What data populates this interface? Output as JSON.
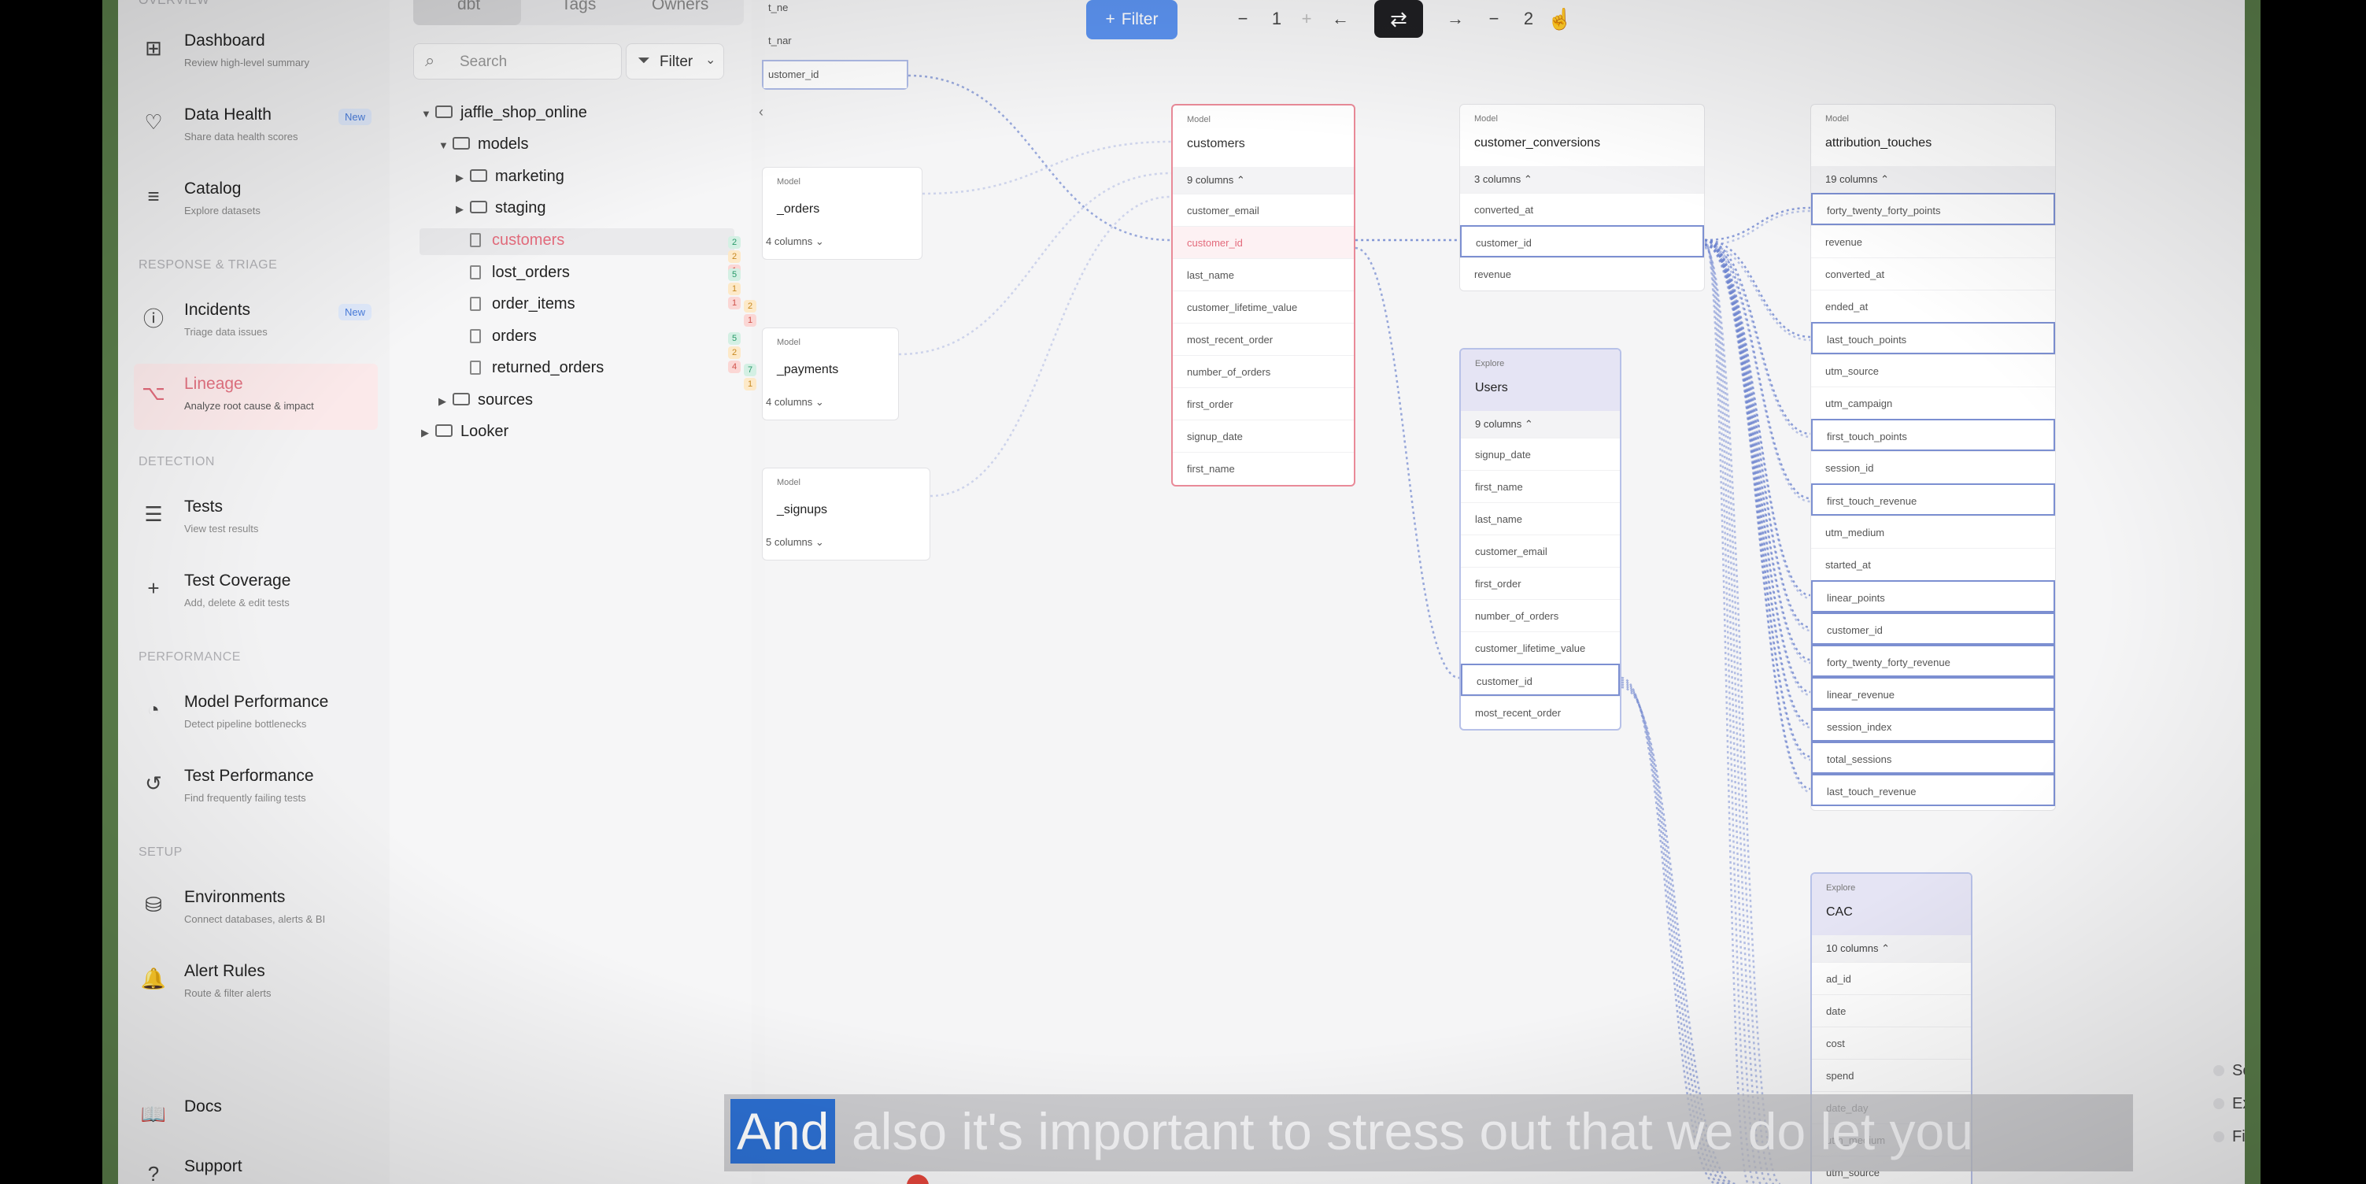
{
  "nav": {
    "section_top": "OVERVIEW",
    "items": [
      {
        "label": "Dashboard",
        "sub": "Review high-level summary",
        "icon": "dashboard-icon"
      },
      {
        "label": "Data Health",
        "sub": "Share data health scores",
        "icon": "heart-icon",
        "badge": "New"
      },
      {
        "label": "Catalog",
        "sub": "Explore datasets",
        "icon": "catalog-icon"
      },
      {
        "label": "Incidents",
        "sub": "Triage data issues",
        "icon": "alert-icon",
        "badge": "New"
      },
      {
        "label": "Lineage",
        "sub": "Analyze root cause & impact",
        "icon": "lineage-icon"
      },
      {
        "label": "Tests",
        "sub": "View test results",
        "icon": "list-icon"
      },
      {
        "label": "Test Coverage",
        "sub": "Add, delete & edit tests",
        "icon": "plus-icon"
      },
      {
        "label": "Model Performance",
        "sub": "Detect pipeline bottlenecks",
        "icon": "gauge-icon"
      },
      {
        "label": "Test Performance",
        "sub": "Find frequently failing tests",
        "icon": "history-icon"
      },
      {
        "label": "Environments",
        "sub": "Connect databases, alerts & BI",
        "icon": "database-icon"
      },
      {
        "label": "Alert Rules",
        "sub": "Route & filter alerts",
        "icon": "bell-icon"
      },
      {
        "label": "Docs",
        "icon": "book-icon"
      },
      {
        "label": "Support",
        "icon": "help-icon"
      }
    ],
    "sections": [
      "RESPONSE & TRIAGE",
      "DETECTION",
      "PERFORMANCE",
      "SETUP"
    ]
  },
  "tree": {
    "tabs": [
      "dbt",
      "Tags",
      "Owners"
    ],
    "search_placeholder": "Search",
    "filter_label": "Filter",
    "nodes": [
      {
        "label": "jaffle_shop_online"
      },
      {
        "label": "models"
      },
      {
        "label": "marketing"
      },
      {
        "label": "staging"
      },
      {
        "label": "customers"
      },
      {
        "label": "lost_orders"
      },
      {
        "label": "order_items"
      },
      {
        "label": "orders"
      },
      {
        "label": "returned_orders"
      },
      {
        "label": "sources"
      },
      {
        "label": "Looker"
      }
    ],
    "pills": {
      "customers": [
        "2",
        "2",
        "1"
      ],
      "lost_orders": [
        "5",
        "1",
        "1"
      ],
      "order_items": [
        "2",
        "1"
      ],
      "orders": [
        "5",
        "2",
        "4"
      ],
      "returned_orders": [
        "7",
        "1"
      ]
    }
  },
  "toolbar": {
    "filter_label": "Filter",
    "minus1": "−",
    "upstream_depth": "1",
    "plus1": "+",
    "left_arrow": "←",
    "swap": "⇄",
    "right_arrow": "→",
    "minus2": "−",
    "downstream_depth": "2"
  },
  "zoom": {
    "plus": "+",
    "minus": "−",
    "reset": "↺"
  },
  "cards": {
    "partial_top": {
      "label1": "t_ne",
      "label2": "t_nar",
      "row": "ustomer_id"
    },
    "orders": {
      "type": "Model",
      "name": "_orders",
      "cols": "4 columns"
    },
    "payments": {
      "type": "Model",
      "name": "_payments",
      "cols": "4 columns"
    },
    "signups": {
      "type": "Model",
      "name": "_signups",
      "cols": "5 columns"
    },
    "customers": {
      "type": "Model",
      "name": "customers",
      "cols": "9 columns",
      "rows": [
        "customer_email",
        "customer_id",
        "last_name",
        "customer_lifetime_value",
        "most_recent_order",
        "number_of_orders",
        "first_order",
        "signup_date",
        "first_name"
      ]
    },
    "customer_conversions": {
      "type": "Model",
      "name": "customer_conversions",
      "cols": "3 columns",
      "rows": [
        "converted_at",
        "customer_id",
        "revenue"
      ]
    },
    "attribution_touches": {
      "type": "Model",
      "name": "attribution_touches",
      "cols": "19 columns",
      "rows": [
        "forty_twenty_forty_points",
        "revenue",
        "converted_at",
        "ended_at",
        "last_touch_points",
        "utm_source",
        "utm_campaign",
        "first_touch_points",
        "session_id",
        "first_touch_revenue",
        "utm_medium",
        "started_at",
        "linear_points",
        "customer_id",
        "forty_twenty_forty_revenue",
        "linear_revenue",
        "session_index",
        "total_sessions",
        "last_touch_revenue"
      ]
    },
    "users": {
      "type": "Explore",
      "name": "Users",
      "cols": "9 columns",
      "rows": [
        "signup_date",
        "first_name",
        "last_name",
        "customer_email",
        "first_order",
        "number_of_orders",
        "customer_lifetime_value",
        "customer_id",
        "most_recent_order"
      ]
    },
    "cac": {
      "type": "Explore",
      "name": "CAC",
      "cols": "10 columns",
      "rows": [
        "ad_id",
        "date",
        "cost",
        "spend",
        "date_day",
        "utm_medium",
        "utm_source"
      ]
    }
  },
  "legend": [
    "Source",
    "Exposure",
    "Filtered"
  ],
  "caption": {
    "first": "And",
    "rest": "also it's important to stress out that we do let you"
  },
  "colors": {
    "accent": "#5b92ef",
    "lineage_active": "#e36b7c",
    "edge": "#6f86cf"
  }
}
